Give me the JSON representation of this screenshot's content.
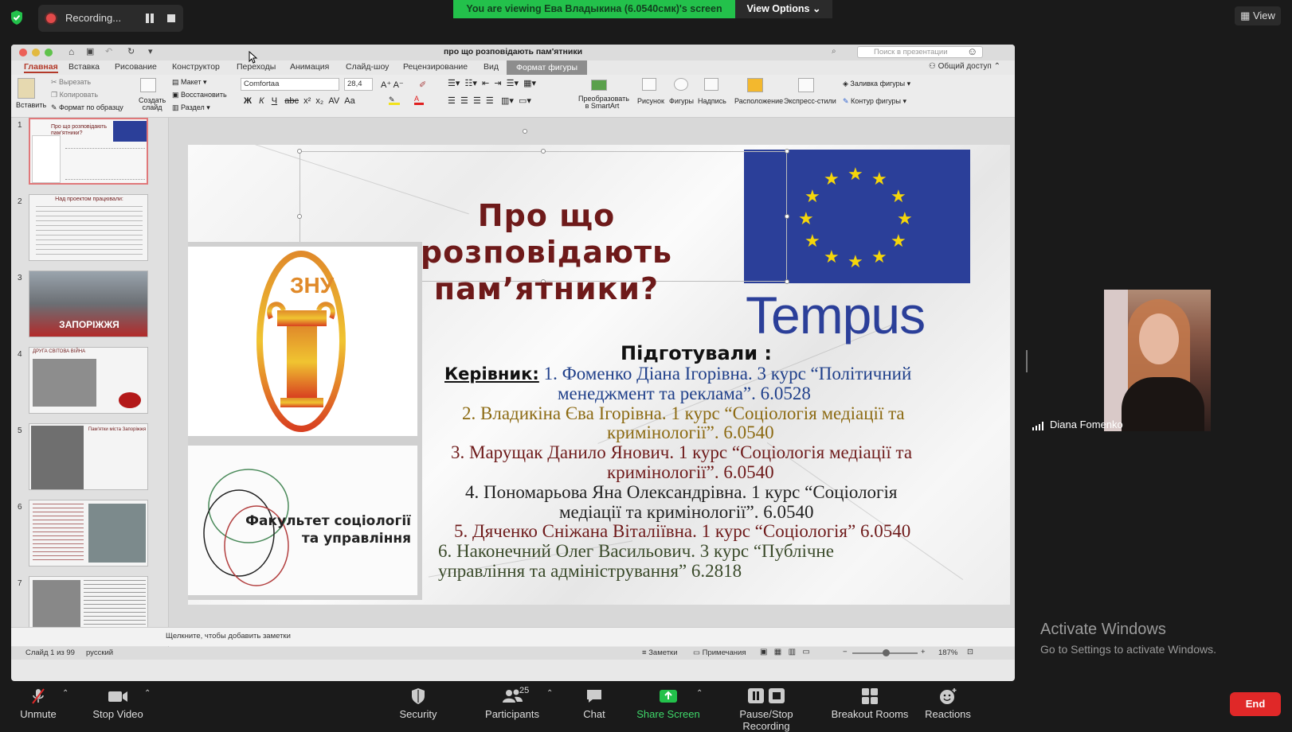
{
  "zoom_top": {
    "recording_label": "Recording...",
    "viewing_banner": "You are viewing Ева Владыкина (6.0540смк)'s screen",
    "view_options": "View Options ⌄",
    "view_button": "View"
  },
  "ppt": {
    "doc_title": "про що розповідають пам'ятники",
    "search_placeholder": "Поиск в презентации",
    "share_label": "Общий доступ",
    "tabs": [
      "Главная",
      "Вставка",
      "Рисование",
      "Конструктор",
      "Переходы",
      "Анимация",
      "Слайд-шоу",
      "Рецензирование",
      "Вид",
      "Формат фигуры"
    ],
    "ribbon": {
      "paste": "Вставить",
      "cut": "Вырезать",
      "copy": "Копировать",
      "format_painter": "Формат по образцу",
      "new_slide": "Создать слайд",
      "layout": "Макет",
      "reset": "Восстановить",
      "section": "Раздел",
      "font": "Comfortaa",
      "font_size": "28,4",
      "smartart": "Преобразовать в SmartArt",
      "picture": "Рисунок",
      "shapes": "Фигуры",
      "textbox": "Надпись",
      "arrange": "Расположение",
      "quick_styles": "Экспресс-стили",
      "shape_fill": "Заливка фигуры",
      "shape_outline": "Контур фигуры"
    },
    "thumbnails": [
      {
        "num": "1",
        "caption": "Про що розповідають пам'ятники?"
      },
      {
        "num": "2",
        "caption": "Над проектом працювали:"
      },
      {
        "num": "3",
        "caption": "ЗАПОРІЖЖЯ"
      },
      {
        "num": "4",
        "caption": "ДРУГА СВІТОВА ВІЙНА"
      },
      {
        "num": "5",
        "caption": "Пам'ятки міста Запоріжжя"
      },
      {
        "num": "6",
        "caption": ""
      },
      {
        "num": "7",
        "caption": ""
      }
    ],
    "slide": {
      "title_line1": "Про що розповідають",
      "title_line2": "пам’ятники?",
      "tempus": "Tempus",
      "faculty": "Факультет соціології та управління",
      "prepared": "Підготували :",
      "supervisor_label": "Керівник:",
      "line1a": " 1. Фоменко Діана Ігорівна. 3 курс “Політичний",
      "line1b": "менеджмент  та реклама”. 6.0528",
      "line2a": "2. Владикіна Єва Ігорівна. 1 курс “Соціологія медіації та",
      "line2b": "кримінології”. 6.0540",
      "line3a": "3. Марущак Данило Янович. 1 курс “Соціологія медіації та",
      "line3b": "кримінології”. 6.0540",
      "line4a": "4. Пономарьова Яна Олександрівна. 1 курс “Соціологія",
      "line4b": "медіації та кримінології”. 6.0540",
      "line5": "5. Дяченко Сніжана Віталіївна. 1 курс “Соціологія” 6.0540",
      "line6a": "6. Наконечний Олег Васильович. 3 курс “Публічне",
      "line6b": "управління та адміністрування” 6.2818"
    },
    "notes_placeholder": "Щелкните, чтобы добавить заметки",
    "status": {
      "slide_of": "Слайд 1 из 99",
      "language": "русский",
      "notes": "Заметки",
      "comments": "Примечания",
      "zoom": "187%"
    }
  },
  "participant": {
    "name": "Diana Fomenko"
  },
  "activate": {
    "title": "Activate Windows",
    "subtitle": "Go to Settings to activate Windows."
  },
  "toolbar": {
    "unmute": "Unmute",
    "stop_video": "Stop Video",
    "security": "Security",
    "participants": "Participants",
    "participants_count": "25",
    "chat": "Chat",
    "share_screen": "Share Screen",
    "pause_stop": "Pause/Stop Recording",
    "breakout": "Breakout Rooms",
    "reactions": "Reactions",
    "end": "End"
  },
  "colors": {
    "zoom_bg": "#1a1a1a",
    "viewing_green": "#23c14b",
    "end_red": "#e02828",
    "share_green": "#23c14b",
    "title_maroon": "#6e1a1a",
    "eu_blue": "#2b3f99"
  }
}
